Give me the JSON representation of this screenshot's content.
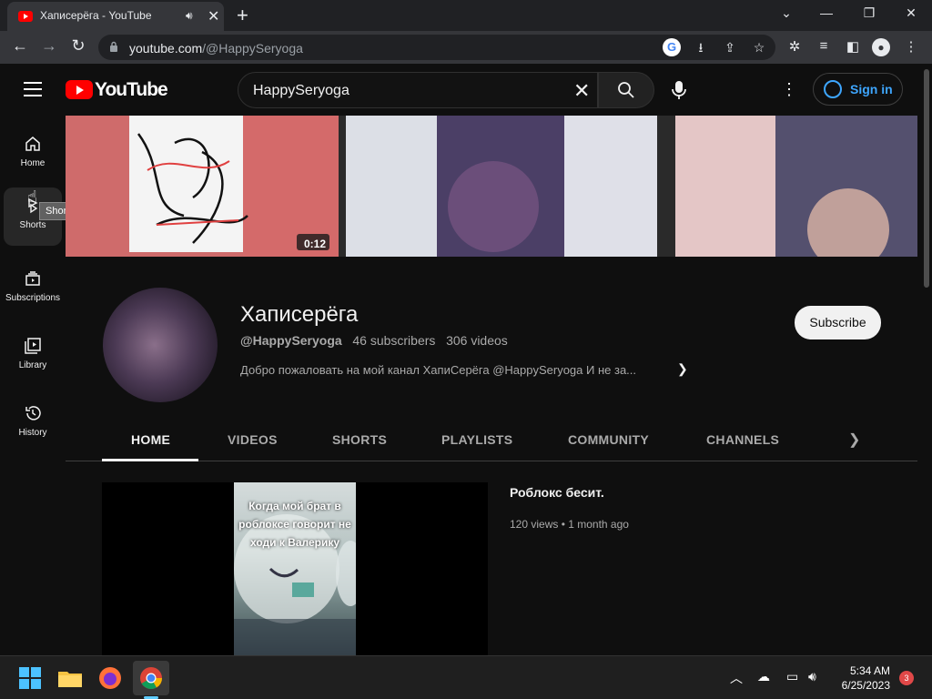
{
  "browser": {
    "tab_title": "Хаписерёга - YouTube",
    "url_domain": "youtube.com",
    "url_path": "/@HappySeryoga"
  },
  "header": {
    "logo_text": "YouTube",
    "search_value": "HappySeryoga",
    "signin_label": "Sign in"
  },
  "sidebar": {
    "items": [
      {
        "label": "Home"
      },
      {
        "label": "Shorts"
      },
      {
        "label": "Subscriptions"
      },
      {
        "label": "Library"
      },
      {
        "label": "History"
      }
    ],
    "tooltip": "Shorts"
  },
  "banner": {
    "duration_badge": "0:12"
  },
  "channel": {
    "name": "Хаписерёга",
    "handle": "@HappySeryoga",
    "subscribers": "46 subscribers",
    "videos": "306 videos",
    "description": "Добро пожаловать на мой канал ХапиСерёга @HappySeryoga И не за...",
    "subscribe_label": "Subscribe"
  },
  "tabs": [
    {
      "label": "HOME"
    },
    {
      "label": "VIDEOS"
    },
    {
      "label": "SHORTS"
    },
    {
      "label": "PLAYLISTS"
    },
    {
      "label": "COMMUNITY"
    },
    {
      "label": "CHANNELS"
    }
  ],
  "featured": {
    "title": "Роблокс бесит.",
    "meta": "120 views • 1 month ago",
    "caption": "Когда мой брат в роблоксе говорит не ходи к Валерику"
  },
  "taskbar": {
    "time": "5:34 AM",
    "date": "6/25/2023",
    "notifications": "3"
  }
}
